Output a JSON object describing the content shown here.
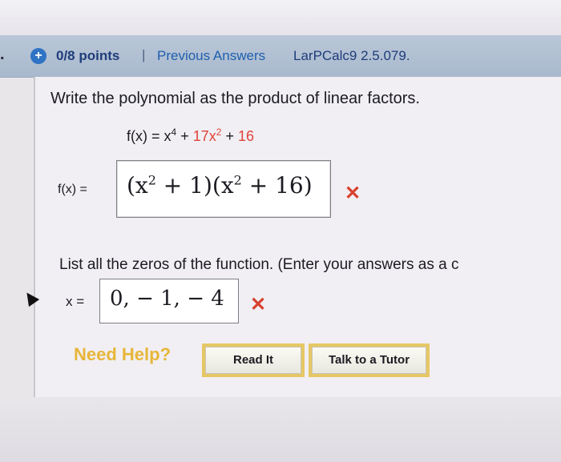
{
  "header": {
    "question_number": ".",
    "status_icon": "plus-circle-icon",
    "points": "0/8 points",
    "separator": "|",
    "previous_answers": "Previous Answers",
    "problem_code": "LarPCalc9 2.5.079."
  },
  "question": {
    "prompt": "Write the polynomial as the product of linear factors.",
    "function": {
      "lhs": "f(x) = x",
      "exp4": "4",
      "plus1": " + ",
      "term2": "17x",
      "exp2": "2",
      "plus2": " + ",
      "const": "16"
    },
    "answer_label": "f(x) =",
    "answer": {
      "p1": "(x",
      "e1": "2",
      "m1": " + 1)(x",
      "e2": "2",
      "m2": " + 16)"
    },
    "answer_status_icon": "incorrect-x-icon"
  },
  "zeros": {
    "instruction": "List all the zeros of the function. (Enter your answers as a c",
    "label": "x =",
    "value": "0, − 1, − 4",
    "status_icon": "incorrect-x-icon"
  },
  "help": {
    "label": "Need Help?",
    "read_it": "Read It",
    "tutor": "Talk to a Tutor"
  },
  "colors": {
    "header_bg": "#b0bfd2",
    "incorrect": "#d8412f",
    "highlight_red": "#e0433a",
    "help_gold": "#e7b63a"
  }
}
